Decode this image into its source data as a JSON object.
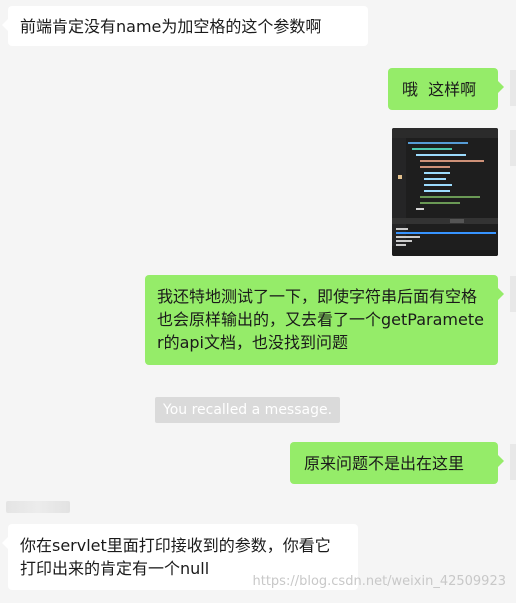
{
  "messages": [
    {
      "text": "前端肯定没有name为加空格的这个参数啊"
    },
    {
      "text": "哦  这样啊"
    },
    {
      "text": "我还特地测试了一下，即使字符串后面有空格也会原样输出的，又去看了一个getParameter的api文档，也没找到问题"
    },
    {
      "text": "原来问题不是出在这里"
    },
    {
      "text": "你在servlet里面打印接收到的参数，你看它打印出来的肯定有一个null"
    }
  ],
  "recall_notice": "You recalled a message.",
  "watermark": "https://blog.csdn.net/weixin_42509923",
  "colors": {
    "sent_bubble": "#95ec69",
    "received_bubble": "#ffffff",
    "background": "#f5f5f5"
  }
}
